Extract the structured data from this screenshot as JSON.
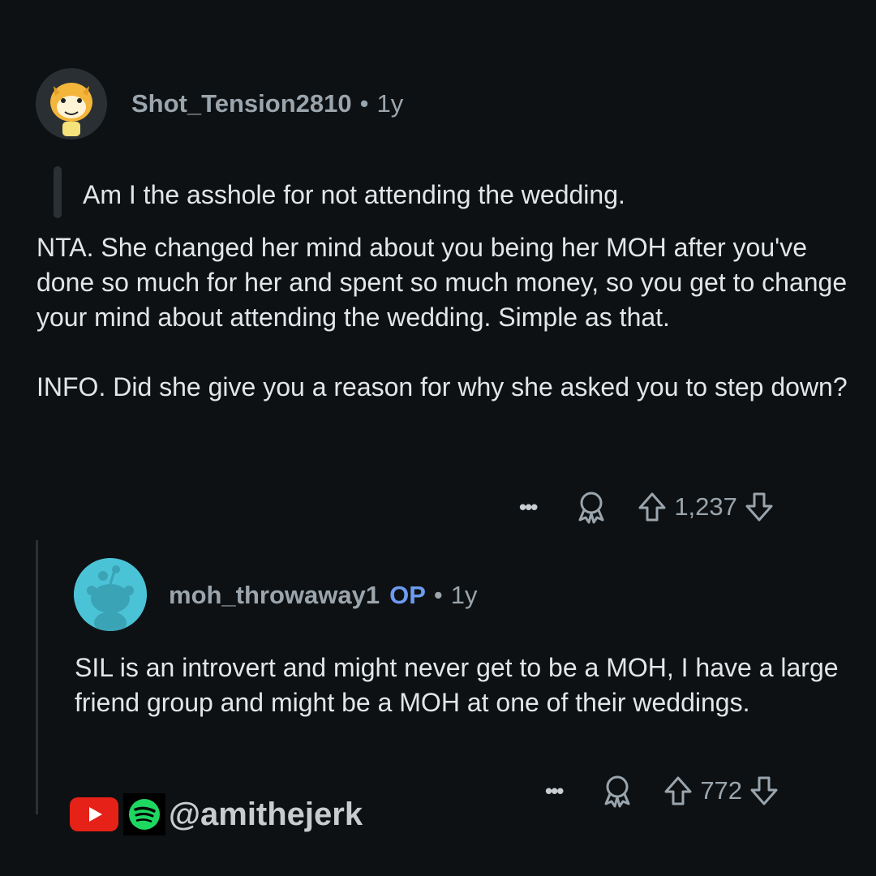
{
  "comment": {
    "username": "Shot_Tension2810",
    "separator": "•",
    "time": "1y",
    "quote": "Am I the asshole for not attending the wedding.",
    "paragraphs": [
      "NTA. She changed her mind about you being her MOH after you've done so much for her and spent so much money, so you get to change your mind about attending the wedding. Simple as that.",
      "INFO. Did she give you a reason for why she asked you to step down?"
    ],
    "more_label": "•••",
    "score": "1,237"
  },
  "reply": {
    "username": "moh_throwaway1",
    "op_badge": "OP",
    "separator": "•",
    "time": "1y",
    "text": "SIL is an introvert and might never get to be a MOH, I have a large friend group and might be a MOH at one of their weddings.",
    "more_label": "•••",
    "score": "772"
  },
  "watermark": {
    "handle": "@amithejerk"
  },
  "colors": {
    "background": "#0e1113",
    "op_badge": "#6d9bf1",
    "youtube": "#e62117",
    "spotify": "#1ed760"
  },
  "icons": [
    "more-icon",
    "award-icon",
    "upvote-icon",
    "downvote-icon",
    "youtube-icon",
    "spotify-icon"
  ]
}
